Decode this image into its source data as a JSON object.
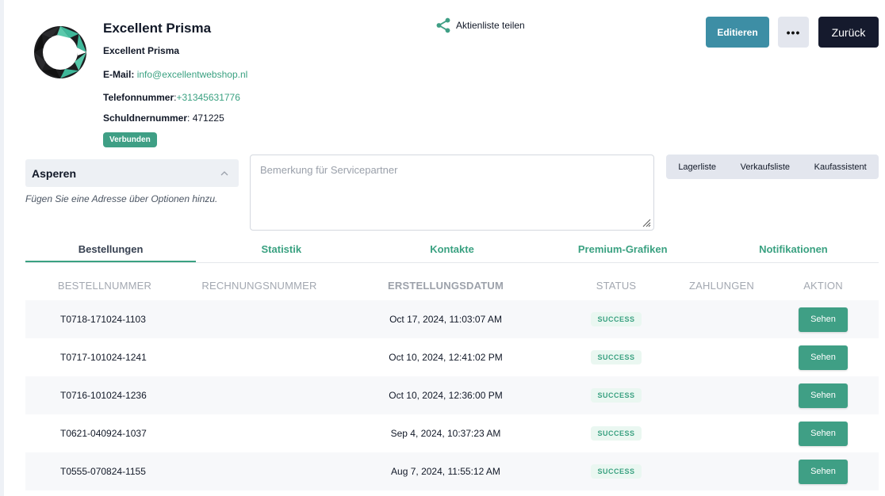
{
  "header": {
    "company_name": "Excellent Prisma",
    "sub_name": "Excellent Prisma",
    "email_label": "E-Mail:",
    "email_value": "info@excellentwebshop.nl",
    "phone_label": "Telefonnummer",
    "phone_value": "+31345631776",
    "debtor_label": "Schuldnernummer",
    "debtor_value": "471225",
    "connected_badge": "Verbunden",
    "share_label": "Aktienliste teilen",
    "edit_label": "Editieren",
    "more_label": "•••",
    "back_label": "Zurück"
  },
  "address": {
    "title": "Asperen",
    "hint": "Fügen Sie eine Adresse über Optionen hinzu."
  },
  "remark": {
    "placeholder": "Bemerkung für Servicepartner"
  },
  "list_tabs": [
    "Lagerliste",
    "Verkaufsliste",
    "Kaufassistent"
  ],
  "tabs": [
    "Bestellungen",
    "Statistik",
    "Kontakte",
    "Premium-Grafiken",
    "Notifikationen"
  ],
  "table": {
    "headers": [
      "BESTELLNUMMER",
      "RECHNUNGSNUMMER",
      "ERSTELLUNGSDATUM",
      "STATUS",
      "ZAHLUNGEN",
      "AKTION"
    ],
    "rows": [
      {
        "order": "T0718-171024-1103",
        "invoice": "",
        "date": "Oct 17, 2024, 11:03:07 AM",
        "status": "SUCCESS",
        "payments": "",
        "action": "Sehen"
      },
      {
        "order": "T0717-101024-1241",
        "invoice": "",
        "date": "Oct 10, 2024, 12:41:02 PM",
        "status": "SUCCESS",
        "payments": "",
        "action": "Sehen"
      },
      {
        "order": "T0716-101024-1236",
        "invoice": "",
        "date": "Oct 10, 2024, 12:36:00 PM",
        "status": "SUCCESS",
        "payments": "",
        "action": "Sehen"
      },
      {
        "order": "T0621-040924-1037",
        "invoice": "",
        "date": "Sep 4, 2024, 10:37:23 AM",
        "status": "SUCCESS",
        "payments": "",
        "action": "Sehen"
      },
      {
        "order": "T0555-070824-1155",
        "invoice": "",
        "date": "Aug 7, 2024, 11:55:12 AM",
        "status": "SUCCESS",
        "payments": "",
        "action": "Sehen"
      }
    ]
  },
  "colors": {
    "accent_green": "#3f9f85",
    "edit_blue": "#3d8ea5",
    "back_dark": "#151a2d"
  }
}
